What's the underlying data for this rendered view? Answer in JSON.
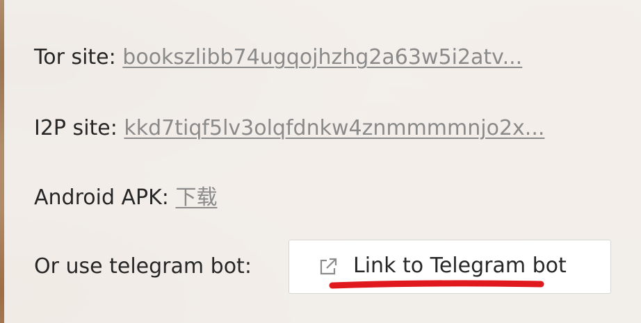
{
  "links": {
    "tor": {
      "label": "Tor site:",
      "link_text": "bookszlibb74ugqojhzhg2a63w5i2atv..."
    },
    "i2p": {
      "label": "I2P site:",
      "link_text": "kkd7tiqf5lv3olqfdnkw4znmmmmnjo2x..."
    },
    "android": {
      "label": "Android APK:",
      "link_text": "下载"
    },
    "telegram": {
      "label": "Or use telegram bot:",
      "button_label": "Link to Telegram bot",
      "button_icon": "external-link-icon"
    }
  },
  "colors": {
    "link": "#8a8a8a",
    "text": "#262626",
    "annotation": "#e0191f"
  }
}
